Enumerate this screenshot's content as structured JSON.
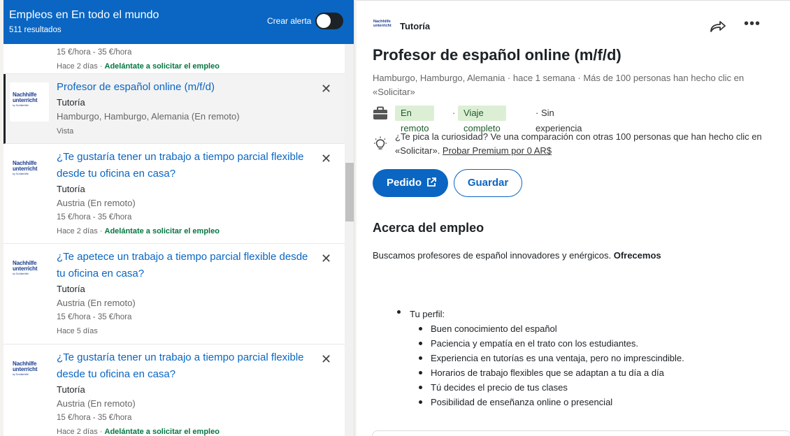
{
  "left_header": {
    "title": "Empleos en En todo el mundo",
    "count": "511 resultados",
    "alert_label": "Crear alerta"
  },
  "logo_text": {
    "line1": "Nachhilfe",
    "line2": "unterricht",
    "sub": "by Schülerhilfe"
  },
  "cards": [
    {
      "salary": "15 €/hora - 35 €/hora",
      "posted": "Hace 2 días",
      "sep": "·",
      "cta": "Adelántate a solicitar el empleo"
    },
    {
      "title": "Profesor de español online (m/f/d)",
      "company": "Tutoría",
      "location": "Hamburgo, Hamburgo, Alemania (En remoto)",
      "status": "Vista",
      "close": "✕"
    },
    {
      "title": "¿Te gustaría tener un trabajo a tiempo parcial flexible desde tu oficina en casa?",
      "company": "Tutoría",
      "location": "Austria (En remoto)",
      "salary": "15 €/hora - 35 €/hora",
      "posted": "Hace 2 días",
      "sep": "·",
      "cta": "Adelántate a solicitar el empleo",
      "close": "✕"
    },
    {
      "title": "¿Te apetece un trabajo a tiempo parcial flexible desde tu oficina en casa?",
      "company": "Tutoría",
      "location": "Austria (En remoto)",
      "salary": "15 €/hora - 35 €/hora",
      "posted": "Hace 5 días",
      "close": "✕"
    },
    {
      "title": "¿Te gustaría tener un trabajo a tiempo parcial flexible desde tu oficina en casa?",
      "company": "Tutoría",
      "location": "Austria (En remoto)",
      "salary": "15 €/hora - 35 €/hora",
      "posted": "Hace 2 días",
      "sep": "·",
      "cta": "Adelántate a solicitar el empleo",
      "close": "✕"
    }
  ],
  "detail": {
    "company": "Tutoría",
    "title": "Profesor de español online (m/f/d)",
    "meta": "Hamburgo, Hamburgo, Alemania · hace 1 semana · Más de 100 personas han hecho clic en «Solicitar»",
    "tag_remote": "En remoto",
    "tag_fulltime": "Viaje completo",
    "sep": "·",
    "experience": "· Sin experiencia",
    "premium_text": "¿Te pica la curiosidad? Ve una comparación con otras 100 personas que han hecho clic en «Solicitar». ",
    "premium_link": "Probar Premium por 0 AR$",
    "apply_label": "Pedido",
    "save_label": "Guardar",
    "about_heading": "Acerca del empleo",
    "description": "Buscamos profesores de español innovadores y enérgicos. ",
    "description_bold": "Ofrecemos",
    "profile_label": "Tu perfil:",
    "profile_items": [
      "Buen conocimiento del español",
      "Paciencia y empatía en el trato con los estudiantes.",
      "Experiencia en tutorías es una ventaja, pero no imprescindible.",
      "Horarios de trabajo flexibles que se adaptan a tu día a día",
      "Tú decides el precio de tus clases",
      "Posibilidad de enseñanza online o presencial"
    ],
    "more_glyph": "•••"
  },
  "colors": {
    "brand": "#0a66c2",
    "green_cta": "#057642",
    "tag_bg": "#dcefd5"
  }
}
